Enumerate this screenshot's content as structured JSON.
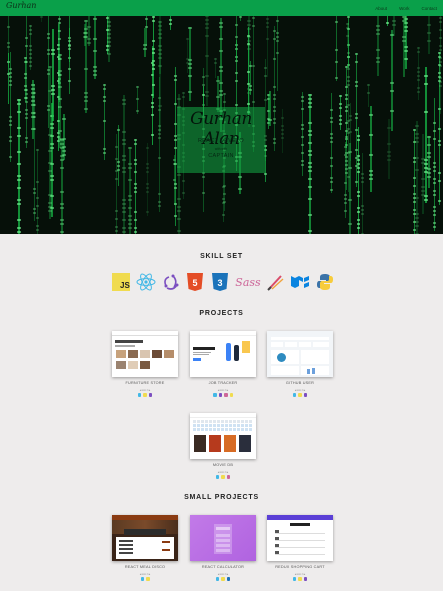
{
  "header": {
    "logo": "Gurhan",
    "nav": [
      "About",
      "Work",
      "Contact"
    ]
  },
  "hero": {
    "signature": "Gurhan Alan",
    "role": "REACT DEVELO",
    "with": "with with",
    "caption": "CAPTAIN"
  },
  "skills": {
    "title": "SKILL SET",
    "icons": [
      "javascript-icon",
      "react-icon",
      "redux-icon",
      "html5-icon",
      "css3-icon",
      "sass-icon",
      "brush-icon",
      "material-ui-icon",
      "python-icon"
    ]
  },
  "projects": {
    "title": "PROJECTS",
    "items": [
      {
        "name": "FURNITURE STORE",
        "meta": "◂  ▪▪▪▪  / ▸"
      },
      {
        "name": "JOB TRACKER",
        "meta": "◂  ▪▪▪▪  / ▸"
      },
      {
        "name": "GITHUB USER",
        "meta": "◂  ▪▪▪▪  / ▸"
      },
      {
        "name": "MOVIE DB",
        "meta": "◂  ▪▪▪▪  / ▸"
      }
    ]
  },
  "small_projects": {
    "title": "SMALL PROJECTS",
    "items": [
      {
        "name": "REACT MEAL DISCO",
        "meta": "◂  ▪▪▪▪  / ▸"
      },
      {
        "name": "REACT CALCULATOR",
        "meta": "◂  ▪▪▪▪  / ▸"
      },
      {
        "name": "REDUX SHOPPING CART",
        "meta": "◂  ▪▪▪▪  / ▸"
      }
    ]
  },
  "colors": {
    "topbar": "#0aa04a",
    "page_bg": "#eeecec",
    "matrix_green": "#18c24a"
  }
}
